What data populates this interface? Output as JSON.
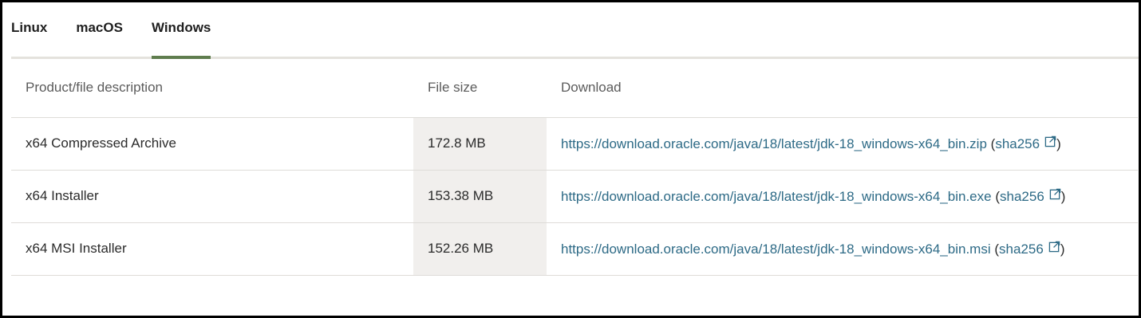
{
  "tabs": [
    {
      "label": "Linux",
      "active": false
    },
    {
      "label": "macOS",
      "active": false
    },
    {
      "label": "Windows",
      "active": true
    }
  ],
  "table": {
    "headers": [
      "Product/file description",
      "File size",
      "Download"
    ],
    "rows": [
      {
        "description": "x64 Compressed Archive",
        "size": "172.8 MB",
        "url": "https://download.oracle.com/java/18/latest/jdk-18_windows-x64_bin.zip",
        "checksum_label": "sha256"
      },
      {
        "description": "x64 Installer",
        "size": "153.38 MB",
        "url": "https://download.oracle.com/java/18/latest/jdk-18_windows-x64_bin.exe",
        "checksum_label": "sha256"
      },
      {
        "description": "x64 MSI Installer",
        "size": "152.26 MB",
        "url": "https://download.oracle.com/java/18/latest/jdk-18_windows-x64_bin.msi",
        "checksum_label": "sha256"
      }
    ]
  },
  "colors": {
    "link": "#2d6a86",
    "active_tab_underline": "#5f7d4e",
    "size_column_bg": "#f1efed"
  },
  "icons": {
    "external_link": "external-link-icon"
  }
}
